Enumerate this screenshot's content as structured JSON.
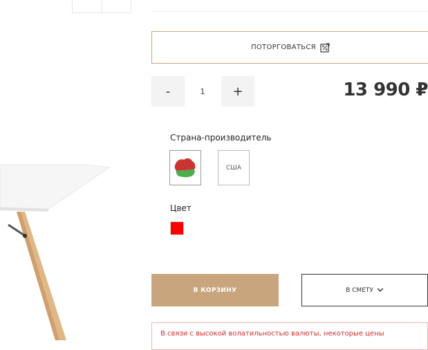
{
  "negotiate": {
    "label": "ПОТОРГОВАТЬСЯ",
    "icon": "negotiate-icon"
  },
  "quantity": {
    "minus_label": "-",
    "value": "1",
    "plus_label": "+"
  },
  "price": "13 990 ₽",
  "country": {
    "label": "Страна-производитель",
    "options": [
      {
        "label": "",
        "icon": "belarus-map-icon",
        "selected": true
      },
      {
        "label": "США",
        "selected": false
      }
    ]
  },
  "color": {
    "label": "Цвет",
    "value": "#ff0000"
  },
  "actions": {
    "cart_label": "В КОРЗИНУ",
    "estimate_label": "В СМЕТУ"
  },
  "notice": "В связи с высокой волатильностью валюты, некоторые цены",
  "colors": {
    "accent": "#c9a57e",
    "notice": "#d42a2a",
    "swatch": "#ff0000"
  }
}
